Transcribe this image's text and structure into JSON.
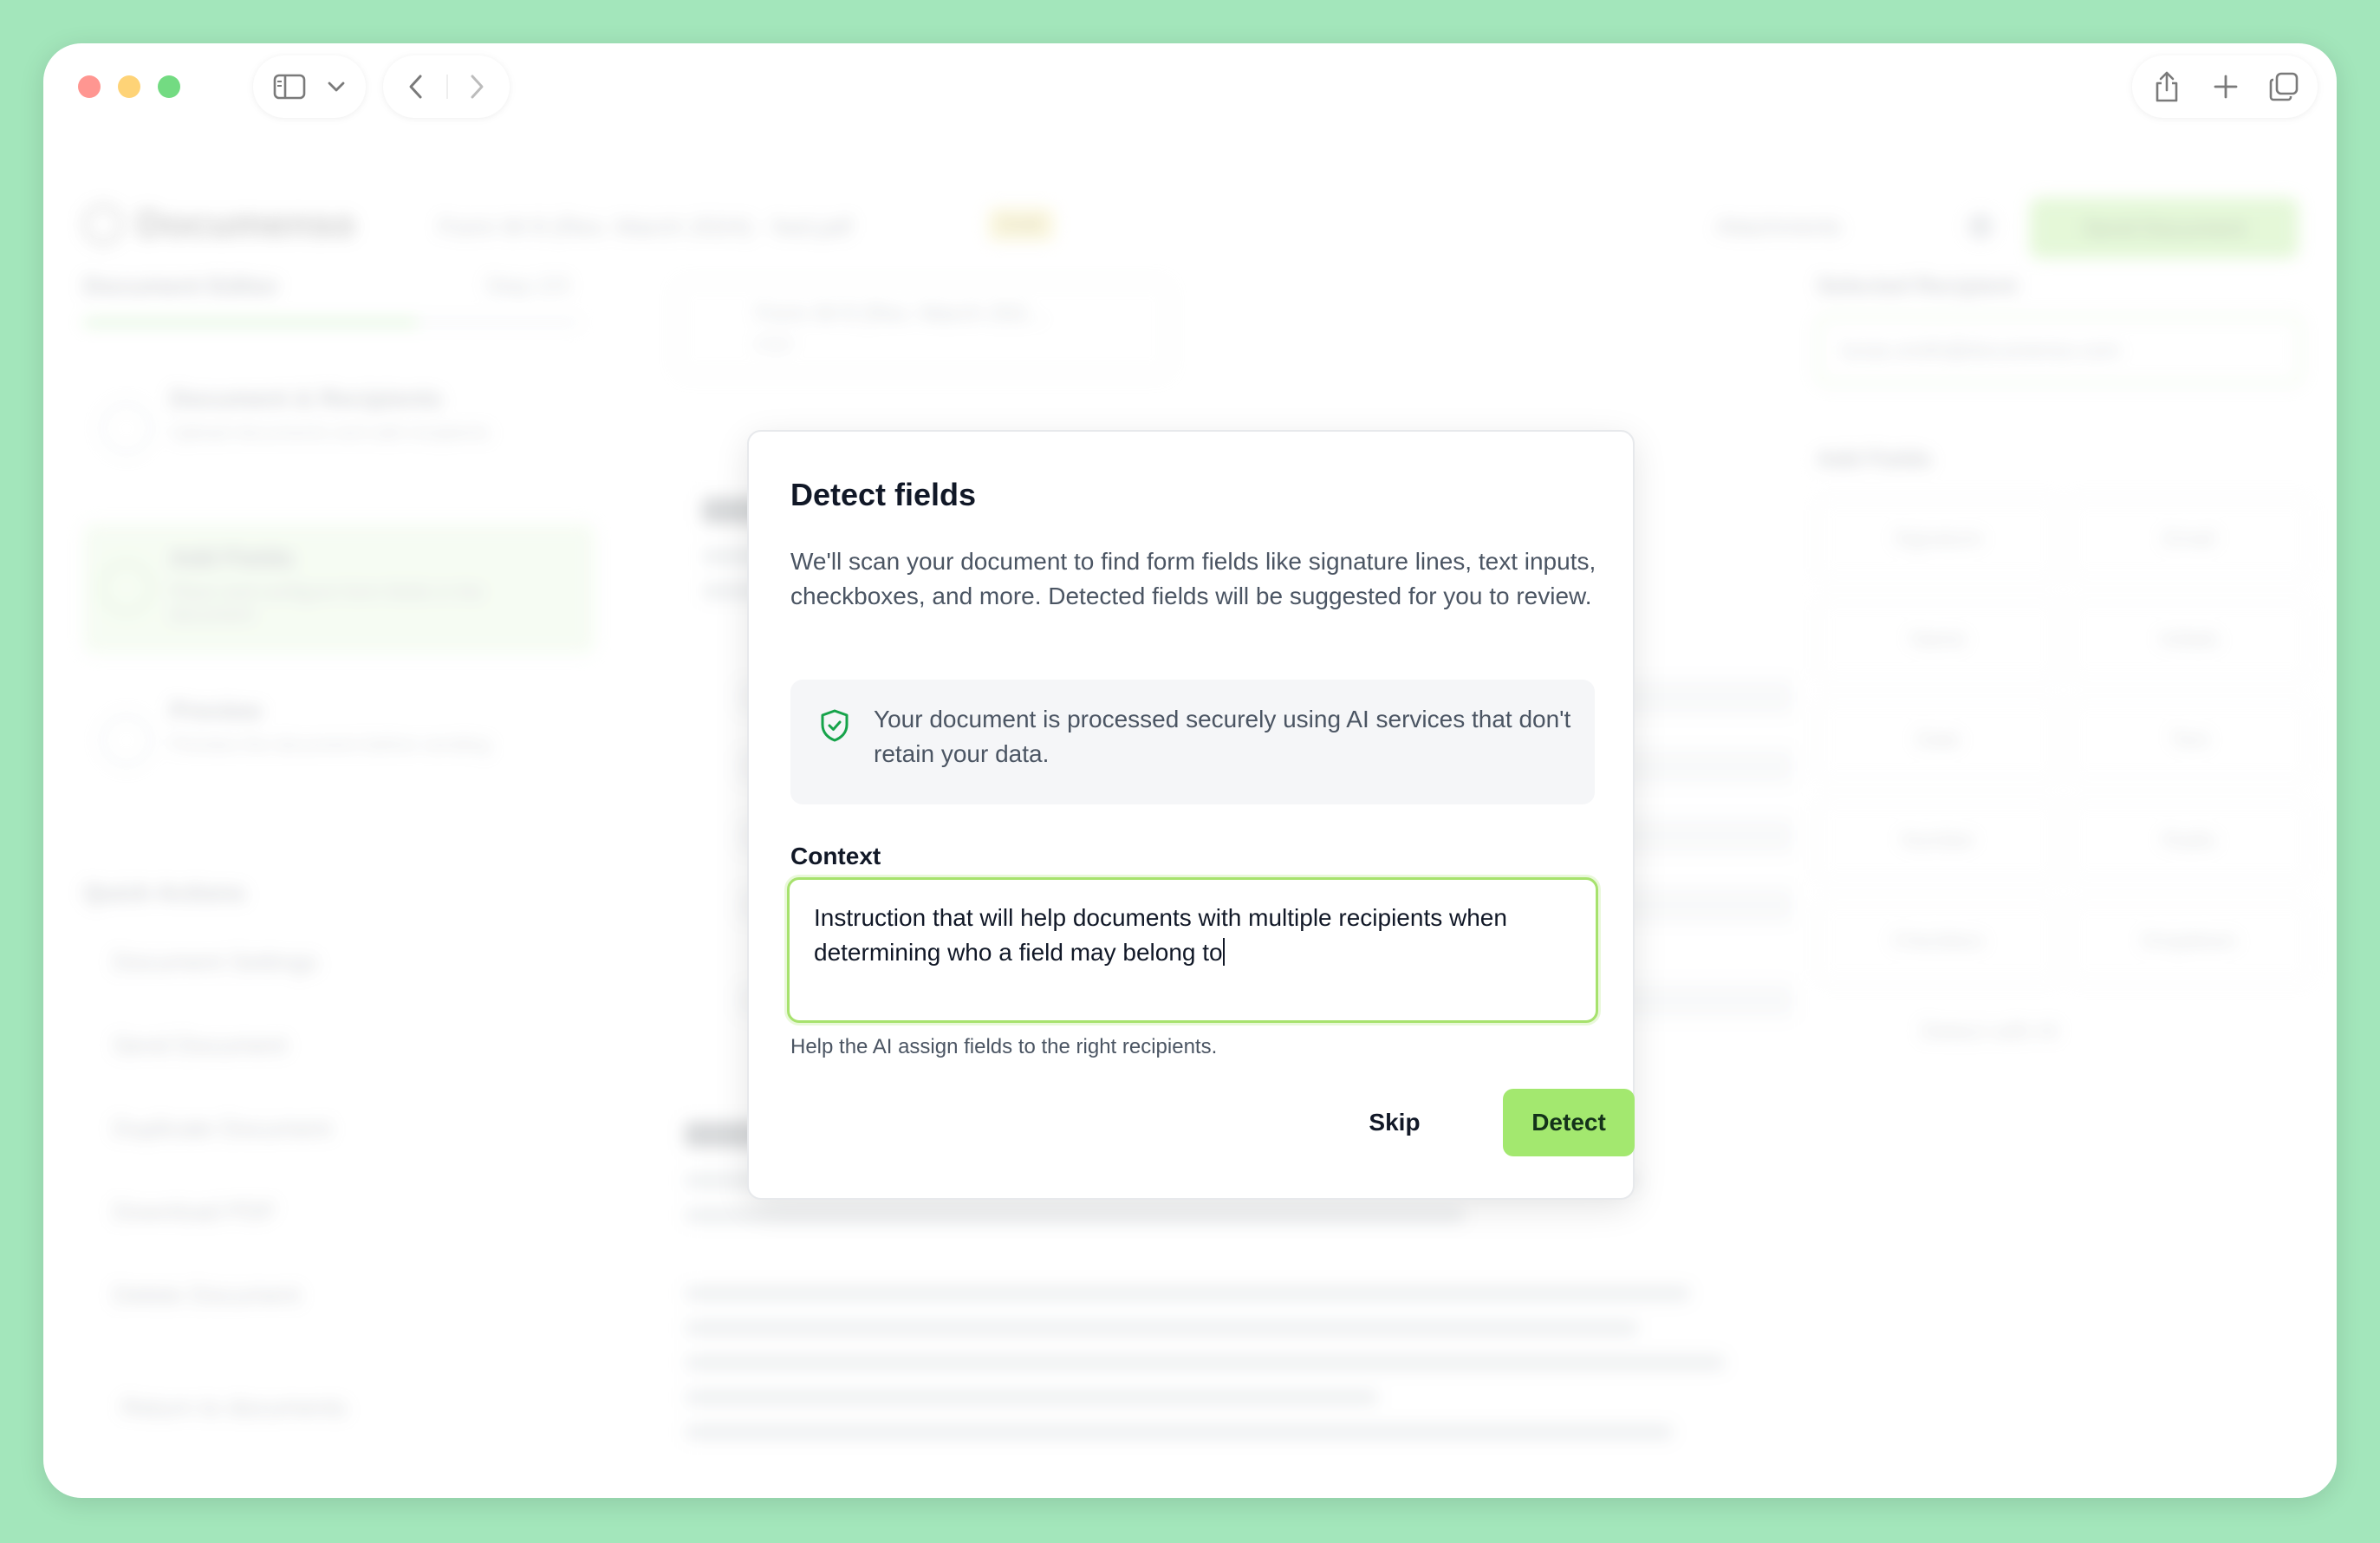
{
  "colors": {
    "backdrop": "#a3e6bb",
    "accent": "#a3e86f",
    "focus_ring": "#a7e26d",
    "shield": "#16a34a"
  },
  "chrome": {
    "icons": [
      "sidebar-icon",
      "chevron-down-icon",
      "back-icon",
      "forward-icon",
      "share-icon",
      "new-tab-icon",
      "tabs-overview-icon"
    ]
  },
  "background": {
    "brand": "Documenso",
    "document_title": "Form W-9 (Rev. March 2024) - fwd.pdf",
    "status_badge": "Draft",
    "attachments": "Attachments",
    "send_button": "Send Document",
    "sidebar_title": "Document Editor",
    "step_counter": "Step 2/3",
    "steps": [
      {
        "title": "Document & Recipients",
        "subtitle": "Upload documents and add recipients"
      },
      {
        "title": "Add Fields",
        "subtitle": "Place and configure form fields in the document"
      },
      {
        "title": "Preview",
        "subtitle": "Preview the document before sending"
      }
    ],
    "quick_actions_title": "Quick Actions",
    "quick_actions": [
      "Document Settings",
      "Send Document",
      "Duplicate Document",
      "Download PDF",
      "Delete Document"
    ],
    "return_link": "Return to documents",
    "file_chip": {
      "name": "Form W-9 (Rev. March 202...",
      "meta": "PDF"
    },
    "selected_recipient_label": "Selected Recipient",
    "recipient_email": "lucas.smith@documenso.com",
    "add_fields_label": "Add Fields",
    "field_types": [
      "Signature",
      "Email",
      "Name",
      "Initials",
      "Date",
      "Text",
      "Number",
      "Radio",
      "Checkbox",
      "Dropdown"
    ],
    "detect_ai": "Detect with AI"
  },
  "dialog": {
    "title": "Detect fields",
    "description": "We'll scan your document to find form fields like signature lines, text inputs, checkboxes, and more. Detected fields will be suggested for you to review.",
    "notice": "Your document is processed securely using AI services that don't retain your data.",
    "context_label": "Context",
    "context_value": "Instruction that will help documents with multiple recipients when determining who a field may belong to",
    "context_help": "Help the AI assign fields to the right recipients.",
    "skip_label": "Skip",
    "detect_label": "Detect"
  }
}
